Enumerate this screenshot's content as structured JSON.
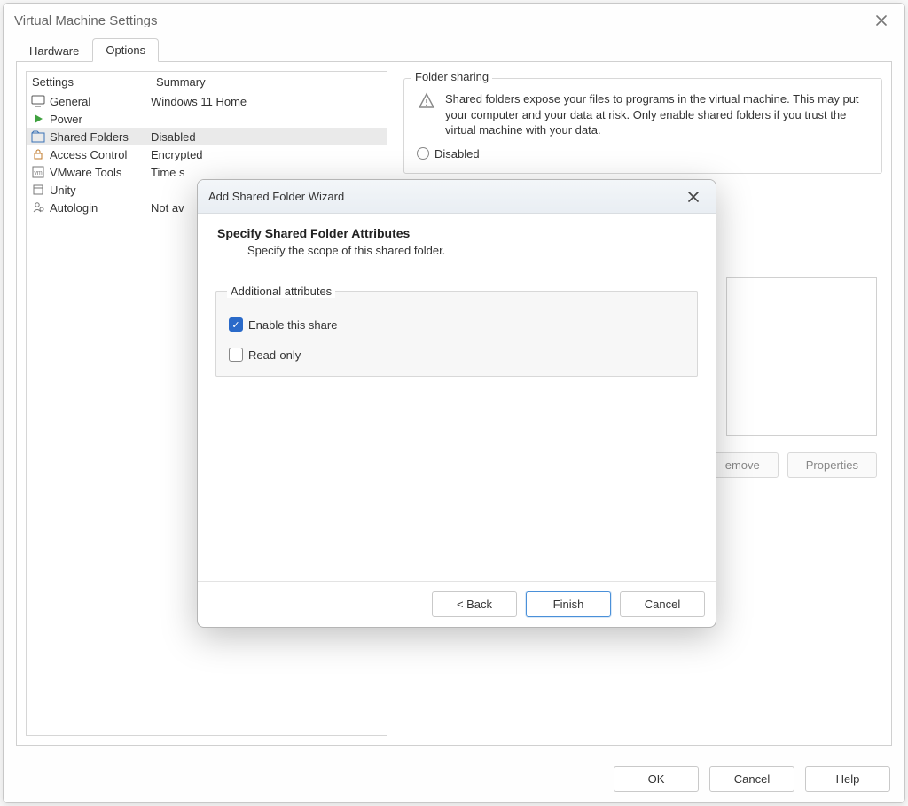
{
  "window": {
    "title": "Virtual Machine Settings",
    "tabs": {
      "hardware": "Hardware",
      "options": "Options"
    }
  },
  "list": {
    "header": {
      "settings": "Settings",
      "summary": "Summary"
    },
    "rows": [
      {
        "icon": "monitor",
        "label": "General",
        "summary": "Windows 11 Home"
      },
      {
        "icon": "play",
        "label": "Power",
        "summary": ""
      },
      {
        "icon": "folder",
        "label": "Shared Folders",
        "summary": "Disabled",
        "selected": true
      },
      {
        "icon": "lock",
        "label": "Access Control",
        "summary": "Encrypted"
      },
      {
        "icon": "vm",
        "label": "VMware Tools",
        "summary": "Time s"
      },
      {
        "icon": "window",
        "label": "Unity",
        "summary": ""
      },
      {
        "icon": "user",
        "label": "Autologin",
        "summary": "Not av"
      }
    ]
  },
  "share_panel": {
    "legend": "Folder sharing",
    "warning": "Shared folders expose your files to programs in the virtual machine. This may put your computer and your data at risk. Only enable shared folders if you trust the virtual machine with your data.",
    "radio_disabled": "Disabled",
    "buttons": {
      "remove": "emove",
      "properties": "Properties"
    }
  },
  "footer": {
    "ok": "OK",
    "cancel": "Cancel",
    "help": "Help"
  },
  "wizard": {
    "title": "Add Shared Folder Wizard",
    "heading": "Specify Shared Folder Attributes",
    "subheading": "Specify the scope of this shared folder.",
    "group_legend": "Additional attributes",
    "enable_label": "Enable this share",
    "readonly_label": "Read-only",
    "buttons": {
      "back": "< Back",
      "finish": "Finish",
      "cancel": "Cancel"
    }
  }
}
